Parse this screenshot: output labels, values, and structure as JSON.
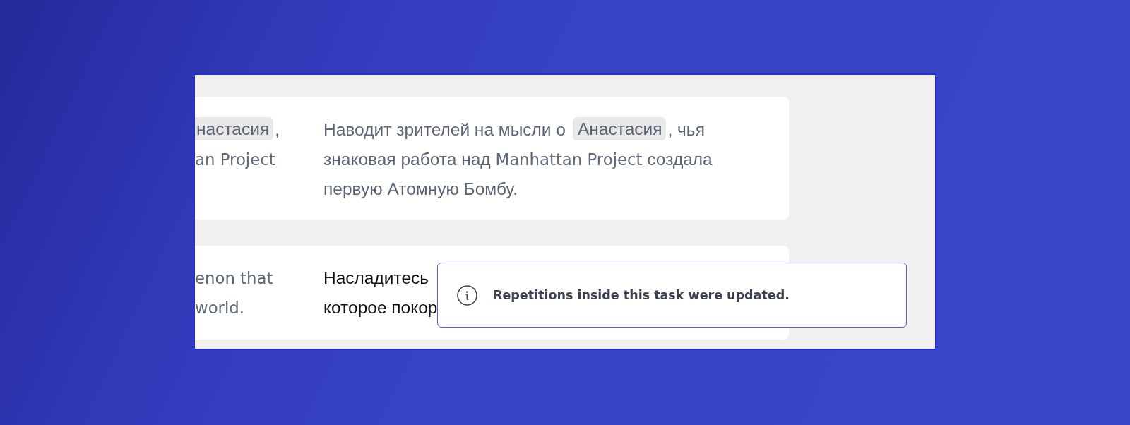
{
  "rows": [
    {
      "active": false,
      "source": {
        "lines": [
          [
            {
              "kind": "chip_clipped",
              "text": "настасия"
            },
            {
              "kind": "text",
              "text": ","
            }
          ],
          [
            {
              "kind": "latin",
              "text": "an Project"
            }
          ]
        ]
      },
      "target": {
        "lines": [
          [
            {
              "kind": "text",
              "text": "Наводит зрителей на мысли о"
            },
            {
              "kind": "chip",
              "text": "Анастасия"
            },
            {
              "kind": "text",
              "text": ", чья"
            }
          ],
          [
            {
              "kind": "text",
              "text": "знаковая работа над "
            },
            {
              "kind": "latin",
              "text": "Manhattan Project"
            },
            {
              "kind": "text",
              "text": " создала"
            }
          ],
          [
            {
              "kind": "text",
              "text": "первую Атомную Бомбу."
            }
          ]
        ]
      }
    },
    {
      "active": true,
      "source": {
        "lines": [
          [
            {
              "kind": "latin",
              "text": "enon that"
            }
          ],
          [
            {
              "kind": "latin",
              "text": "world."
            }
          ]
        ]
      },
      "target": {
        "lines": [
          [
            {
              "kind": "text",
              "text": "Насладитесь"
            }
          ],
          [
            {
              "kind": "text",
              "text": "которое покор"
            }
          ]
        ]
      }
    }
  ],
  "toast": {
    "message": "Repetitions inside this task were updated."
  }
}
